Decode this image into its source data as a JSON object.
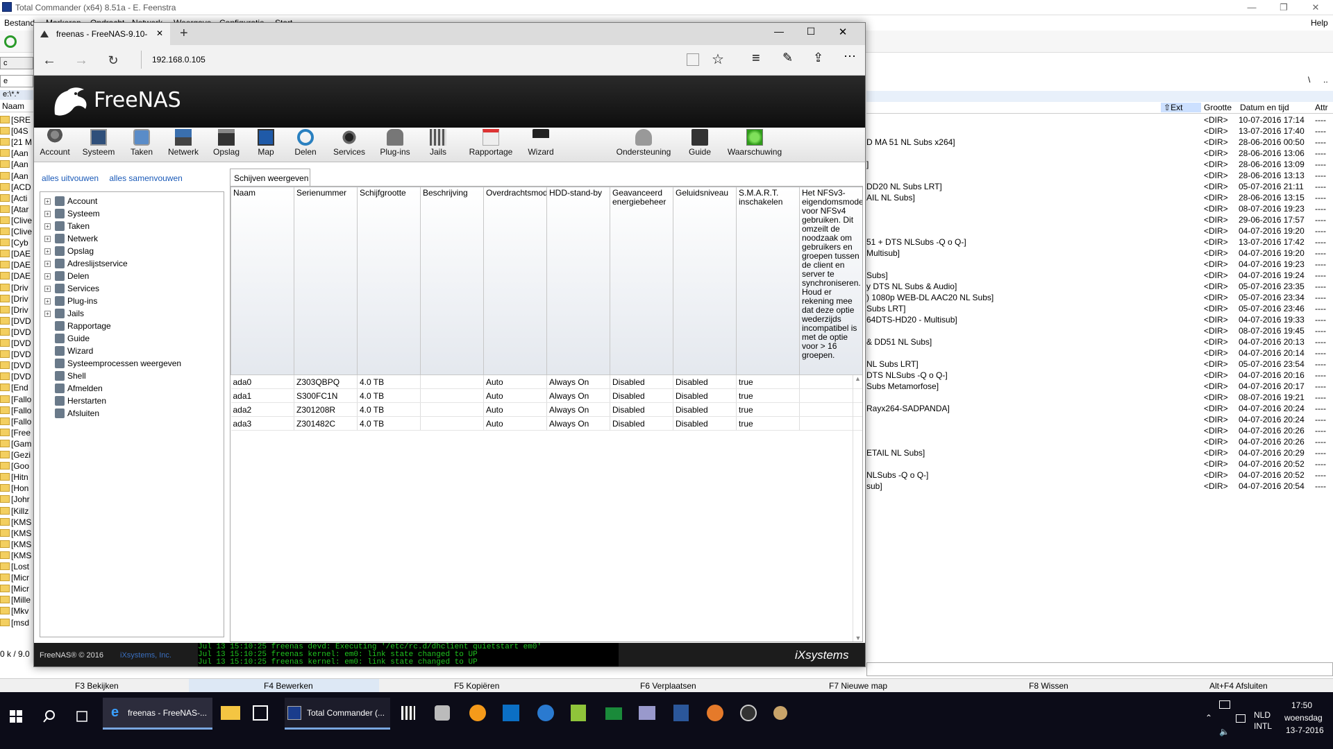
{
  "tc": {
    "title": "Total Commander (x64) 8.51a - E. Feenstra",
    "menu": [
      "Bestand",
      "Markeren",
      "Opdracht",
      "Netwerk",
      "Weergave",
      "Configuratie",
      "Start"
    ],
    "help": "Help",
    "drive_left": "c",
    "drive_left2": "e",
    "path_left": "e:\\*.*",
    "col_name": "Naam",
    "status_left": "0 k / 9.0",
    "left_folders": [
      "[SRE",
      "[04S",
      "[21 M",
      "[Aan",
      "[Aan",
      "[Aan",
      "[ACD",
      "[Acti",
      "[Atar",
      "[Clive",
      "[Clive",
      "[Cyb",
      "[DAE",
      "[DAE",
      "[DAE",
      "[Driv",
      "[Driv",
      "[Driv",
      "[DVD",
      "[DVD",
      "[DVD",
      "[DVD",
      "[DVD",
      "[DVD",
      "[End",
      "[Fallo",
      "[Fallo",
      "[Fallo",
      "[Free",
      "[Gam",
      "[Gezi",
      "[Goo",
      "[Hitn",
      "[Hon",
      "[Johr",
      "[Killz",
      "[KMS",
      "[KMS",
      "[KMS",
      "[KMS",
      "[Lost",
      "[Micr",
      "[Micr",
      "[Mille",
      "[Mkv",
      "[msd"
    ],
    "right_header": {
      "ext": "Ext",
      "size": "Grootte",
      "date": "Datum en tijd",
      "attr": "Attr"
    },
    "right_rows": [
      {
        "name": "",
        "dir": "<DIR>",
        "date": "10-07-2016 17:14",
        "attr": "----"
      },
      {
        "name": "",
        "dir": "<DIR>",
        "date": "13-07-2016 17:40",
        "attr": "----"
      },
      {
        "name": "D MA 51 NL Subs x264]",
        "dir": "<DIR>",
        "date": "28-06-2016 00:50",
        "attr": "----"
      },
      {
        "name": "",
        "dir": "<DIR>",
        "date": "28-06-2016 13:06",
        "attr": "----"
      },
      {
        "name": "]",
        "dir": "<DIR>",
        "date": "28-06-2016 13:09",
        "attr": "----"
      },
      {
        "name": "",
        "dir": "<DIR>",
        "date": "28-06-2016 13:13",
        "attr": "----"
      },
      {
        "name": "DD20 NL Subs LRT]",
        "dir": "<DIR>",
        "date": "05-07-2016 21:11",
        "attr": "----"
      },
      {
        "name": "AIL NL Subs]",
        "dir": "<DIR>",
        "date": "28-06-2016 13:15",
        "attr": "----"
      },
      {
        "name": "",
        "dir": "<DIR>",
        "date": "08-07-2016 19:23",
        "attr": "----"
      },
      {
        "name": "",
        "dir": "<DIR>",
        "date": "29-06-2016 17:57",
        "attr": "----"
      },
      {
        "name": "",
        "dir": "<DIR>",
        "date": "04-07-2016 19:20",
        "attr": "----"
      },
      {
        "name": "51 + DTS NLSubs -Q o Q-]",
        "dir": "<DIR>",
        "date": "13-07-2016 17:42",
        "attr": "----"
      },
      {
        "name": "Multisub]",
        "dir": "<DIR>",
        "date": "04-07-2016 19:20",
        "attr": "----"
      },
      {
        "name": "",
        "dir": "<DIR>",
        "date": "04-07-2016 19:23",
        "attr": "----"
      },
      {
        "name": "Subs]",
        "dir": "<DIR>",
        "date": "04-07-2016 19:24",
        "attr": "----"
      },
      {
        "name": "y DTS NL Subs & Audio]",
        "dir": "<DIR>",
        "date": "05-07-2016 23:35",
        "attr": "----"
      },
      {
        "name": ") 1080p WEB-DL AAC20 NL Subs]",
        "dir": "<DIR>",
        "date": "05-07-2016 23:34",
        "attr": "----"
      },
      {
        "name": "Subs LRT]",
        "dir": "<DIR>",
        "date": "05-07-2016 23:46",
        "attr": "----"
      },
      {
        "name": "64DTS-HD20 - Multisub]",
        "dir": "<DIR>",
        "date": "04-07-2016 19:33",
        "attr": "----"
      },
      {
        "name": "",
        "dir": "<DIR>",
        "date": "08-07-2016 19:45",
        "attr": "----"
      },
      {
        "name": "& DD51 NL Subs]",
        "dir": "<DIR>",
        "date": "04-07-2016 20:13",
        "attr": "----"
      },
      {
        "name": "",
        "dir": "<DIR>",
        "date": "04-07-2016 20:14",
        "attr": "----"
      },
      {
        "name": "NL Subs LRT]",
        "dir": "<DIR>",
        "date": "05-07-2016 23:54",
        "attr": "----"
      },
      {
        "name": " DTS NLSubs -Q o Q-]",
        "dir": "<DIR>",
        "date": "04-07-2016 20:16",
        "attr": "----"
      },
      {
        "name": "Subs Metamorfose]",
        "dir": "<DIR>",
        "date": "04-07-2016 20:17",
        "attr": "----"
      },
      {
        "name": "",
        "dir": "<DIR>",
        "date": "08-07-2016 19:21",
        "attr": "----"
      },
      {
        "name": "Rayx264-SADPANDA]",
        "dir": "<DIR>",
        "date": "04-07-2016 20:24",
        "attr": "----"
      },
      {
        "name": "",
        "dir": "<DIR>",
        "date": "04-07-2016 20:24",
        "attr": "----"
      },
      {
        "name": "",
        "dir": "<DIR>",
        "date": "04-07-2016 20:26",
        "attr": "----"
      },
      {
        "name": "",
        "dir": "<DIR>",
        "date": "04-07-2016 20:26",
        "attr": "----"
      },
      {
        "name": "ETAIL NL Subs]",
        "dir": "<DIR>",
        "date": "04-07-2016 20:29",
        "attr": "----"
      },
      {
        "name": "",
        "dir": "<DIR>",
        "date": "04-07-2016 20:52",
        "attr": "----"
      },
      {
        "name": "NLSubs -Q o Q-]",
        "dir": "<DIR>",
        "date": "04-07-2016 20:52",
        "attr": "----"
      },
      {
        "name": "sub]",
        "dir": "<DIR>",
        "date": "04-07-2016 20:54",
        "attr": "----"
      }
    ],
    "fkeys": [
      "F3 Bekijken",
      "F4 Bewerken",
      "F5 Kopiëren",
      "F6 Verplaatsen",
      "F7 Nieuwe map",
      "F8 Wissen",
      "Alt+F4 Afsluiten"
    ]
  },
  "browser": {
    "tab_title": "freenas - FreeNAS-9.10-",
    "tab_close": "✕",
    "new_tab": "+",
    "url": "192.168.0.105"
  },
  "freenas": {
    "logo_text": "FreeNAS",
    "toolbar": [
      "Account",
      "Systeem",
      "Taken",
      "Netwerk",
      "Opslag",
      "Map",
      "Delen",
      "Services",
      "Plug-ins",
      "Jails",
      "Rapportage",
      "Wizard",
      "Ondersteuning",
      "Guide",
      "Waarschuwing"
    ],
    "expand_all": "alles uitvouwen",
    "collapse_all": "alles samenvouwen",
    "tree": [
      {
        "label": "Account",
        "icon": "account-icon",
        "exp": true
      },
      {
        "label": "Systeem",
        "icon": "system-icon",
        "exp": true
      },
      {
        "label": "Taken",
        "icon": "tasks-icon",
        "exp": true
      },
      {
        "label": "Netwerk",
        "icon": "network-icon",
        "exp": true
      },
      {
        "label": "Opslag",
        "icon": "storage-icon",
        "exp": true
      },
      {
        "label": "Adreslijstservice",
        "icon": "directory-icon",
        "exp": true
      },
      {
        "label": "Delen",
        "icon": "sharing-icon",
        "exp": true
      },
      {
        "label": "Services",
        "icon": "services-icon",
        "exp": true
      },
      {
        "label": "Plug-ins",
        "icon": "plugins-icon",
        "exp": true
      },
      {
        "label": "Jails",
        "icon": "jails-icon",
        "exp": true
      },
      {
        "label": "Rapportage",
        "icon": "reporting-icon",
        "exp": false
      },
      {
        "label": "Guide",
        "icon": "guide-icon",
        "exp": false
      },
      {
        "label": "Wizard",
        "icon": "wizard-icon",
        "exp": false
      },
      {
        "label": "Systeemprocessen weergeven",
        "icon": "processes-icon",
        "exp": false
      },
      {
        "label": "Shell",
        "icon": "shell-icon",
        "exp": false
      },
      {
        "label": "Afmelden",
        "icon": "logout-icon",
        "exp": false
      },
      {
        "label": "Herstarten",
        "icon": "reboot-icon",
        "exp": false
      },
      {
        "label": "Afsluiten",
        "icon": "shutdown-icon",
        "exp": false
      }
    ],
    "subtab": "Schijven weergeven",
    "columns": [
      "Naam",
      "Serienummer",
      "Schijfgrootte",
      "Beschrijving",
      "Overdrachtsmodus",
      "HDD-stand-by",
      "Geavanceerd energiebeheer",
      "Geluidsniveau",
      "S.M.A.R.T. inschakelen",
      "Het NFSv3-eigendomsmodel voor NFSv4 gebruiken. Dit omzeilt de noodzaak om gebruikers en groepen tussen de client en server te synchroniseren. Houd er rekening mee dat deze optie wederzijds incompatibel is met de optie voor > 16 groepen."
    ],
    "rows": [
      [
        "ada0",
        "Z303QBPQ",
        "4.0 TB",
        "",
        "Auto",
        "Always On",
        "Disabled",
        "Disabled",
        "true",
        ""
      ],
      [
        "ada1",
        "S300FC1N",
        "4.0 TB",
        "",
        "Auto",
        "Always On",
        "Disabled",
        "Disabled",
        "true",
        ""
      ],
      [
        "ada2",
        "Z301208R",
        "4.0 TB",
        "",
        "Auto",
        "Always On",
        "Disabled",
        "Disabled",
        "true",
        ""
      ],
      [
        "ada3",
        "Z301482C",
        "4.0 TB",
        "",
        "Auto",
        "Always On",
        "Disabled",
        "Disabled",
        "true",
        ""
      ]
    ],
    "footer_copy": "FreeNAS® © 2016",
    "footer_link": "iXsystems, Inc.",
    "console": [
      "Jul 13 15:10:25 freenas devd: Executing '/etc/rc.d/dhclient quietstart em0'",
      "Jul 13 15:10:25 freenas kernel: em0: link state changed to UP",
      "Jul 13 15:10:25 freenas kernel: em0: link state changed to UP"
    ],
    "ix_logo": "iXsystems"
  },
  "taskbar": {
    "browser_task": "freenas - FreeNAS-...",
    "tc_task": "Total Commander (...",
    "lang1": "NLD",
    "lang2": "INTL",
    "time": "17:50",
    "day": "woensdag",
    "date": "13-7-2016"
  },
  "colors": {
    "accent": "#1a5ab8",
    "console_green": "#1fc41f",
    "header_dark": "#1c1c1c"
  }
}
